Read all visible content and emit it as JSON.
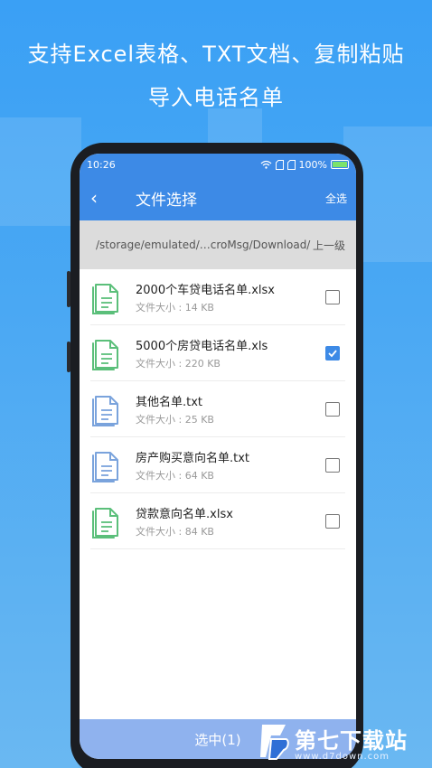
{
  "headline": {
    "line1": "支持Excel表格、TXT文档、复制粘贴",
    "line2": "导入电话名单"
  },
  "status_bar": {
    "time": "10:26",
    "battery": "100%"
  },
  "app_bar": {
    "title": "文件选择",
    "select_all": "全选",
    "back_icon": "chevron-left-icon"
  },
  "path_bar": {
    "path": "/storage/emulated/…croMsg/Download/",
    "up_level": "上一级"
  },
  "files": [
    {
      "name": "2000个车贷电话名单.xlsx",
      "size": "文件大小 : 14 KB",
      "type": "xlsx",
      "checked": false,
      "color": "#5bbf7a"
    },
    {
      "name": "5000个房贷电话名单.xls",
      "size": "文件大小 : 220 KB",
      "type": "xls",
      "checked": true,
      "color": "#5bbf7a"
    },
    {
      "name": "其他名单.txt",
      "size": "文件大小 : 25 KB",
      "type": "txt",
      "checked": false,
      "color": "#7aa3dc"
    },
    {
      "name": "房产购买意向名单.txt",
      "size": "文件大小 : 64 KB",
      "type": "txt",
      "checked": false,
      "color": "#7aa3dc"
    },
    {
      "name": "贷款意向名单.xlsx",
      "size": "文件大小 : 84 KB",
      "type": "xlsx",
      "checked": false,
      "color": "#5bbf7a"
    }
  ],
  "bottom_bar": {
    "label": "选中(1)"
  },
  "watermark": {
    "text": "第七下载站",
    "url": "www.d7down.com"
  },
  "colors": {
    "primary": "#3d8ae6",
    "bottom_bar": "#8fb2ee"
  }
}
